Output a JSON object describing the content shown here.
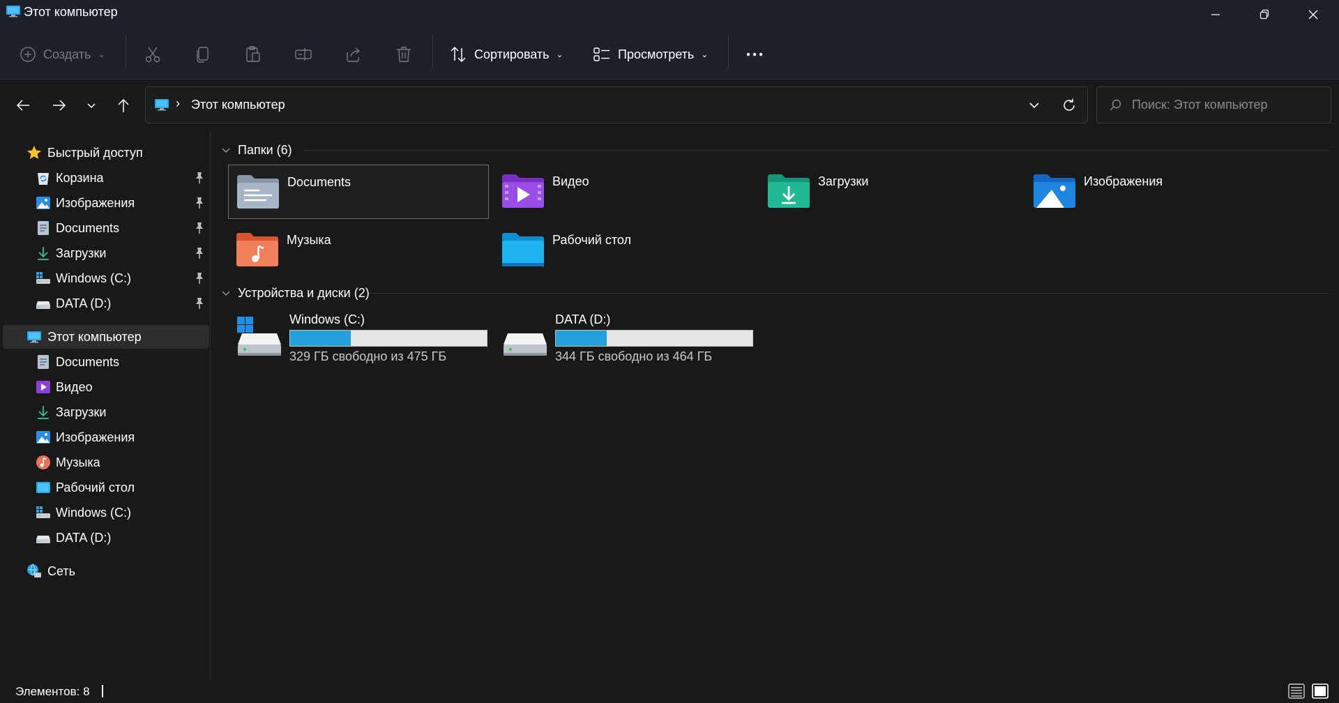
{
  "window": {
    "title": "Этот компьютер",
    "controls": [
      "minimize",
      "restore",
      "close"
    ]
  },
  "toolbar": {
    "new_label": "Создать",
    "sort_label": "Сортировать",
    "view_label": "Просмотреть",
    "disabled_icons": [
      "cut-icon",
      "copy-icon",
      "paste-icon",
      "rename-icon",
      "share-icon",
      "delete-icon"
    ]
  },
  "address": {
    "path": "Этот компьютер",
    "separator": "›"
  },
  "search": {
    "placeholder": "Поиск: Этот компьютер"
  },
  "sidebar": {
    "quick_access": {
      "label": "Быстрый доступ",
      "items": [
        {
          "label": "Корзина",
          "icon": "recycle-bin-icon",
          "pinned": true
        },
        {
          "label": "Изображения",
          "icon": "pictures-icon",
          "pinned": true
        },
        {
          "label": "Documents",
          "icon": "documents-icon",
          "pinned": true
        },
        {
          "label": "Загрузки",
          "icon": "downloads-icon",
          "pinned": true
        },
        {
          "label": "Windows (C:)",
          "icon": "windows-drive-icon",
          "pinned": true
        },
        {
          "label": "DATA (D:)",
          "icon": "drive-icon",
          "pinned": true
        }
      ]
    },
    "this_pc": {
      "label": "Этот компьютер",
      "items": [
        {
          "label": "Documents",
          "icon": "documents-icon"
        },
        {
          "label": "Видео",
          "icon": "videos-icon"
        },
        {
          "label": "Загрузки",
          "icon": "downloads-icon"
        },
        {
          "label": "Изображения",
          "icon": "pictures-icon"
        },
        {
          "label": "Музыка",
          "icon": "music-icon"
        },
        {
          "label": "Рабочий стол",
          "icon": "desktop-icon"
        },
        {
          "label": "Windows (C:)",
          "icon": "windows-drive-icon"
        },
        {
          "label": "DATA (D:)",
          "icon": "drive-icon"
        }
      ]
    },
    "network": {
      "label": "Сеть",
      "icon": "network-icon"
    }
  },
  "main": {
    "folders_group": "Папки (6)",
    "folders": [
      {
        "name": "Documents",
        "icon": "documents-folder-icon"
      },
      {
        "name": "Видео",
        "icon": "videos-folder-icon"
      },
      {
        "name": "Загрузки",
        "icon": "downloads-folder-icon"
      },
      {
        "name": "Изображения",
        "icon": "pictures-folder-icon"
      },
      {
        "name": "Музыка",
        "icon": "music-folder-icon"
      },
      {
        "name": "Рабочий стол",
        "icon": "desktop-folder-icon"
      }
    ],
    "devices_group": "Устройства и диски (2)",
    "drives": [
      {
        "name": "Windows (C:)",
        "info": "329 ГБ свободно из 475 ГБ",
        "used_fraction": 0.307
      },
      {
        "name": "DATA (D:)",
        "info": "344 ГБ свободно из 464 ГБ",
        "used_fraction": 0.259
      }
    ]
  },
  "status": {
    "count": "Элементов: 8"
  },
  "colors": {
    "accent": "#26a0da",
    "background": "#191919",
    "titlebar": "#1c2129"
  }
}
